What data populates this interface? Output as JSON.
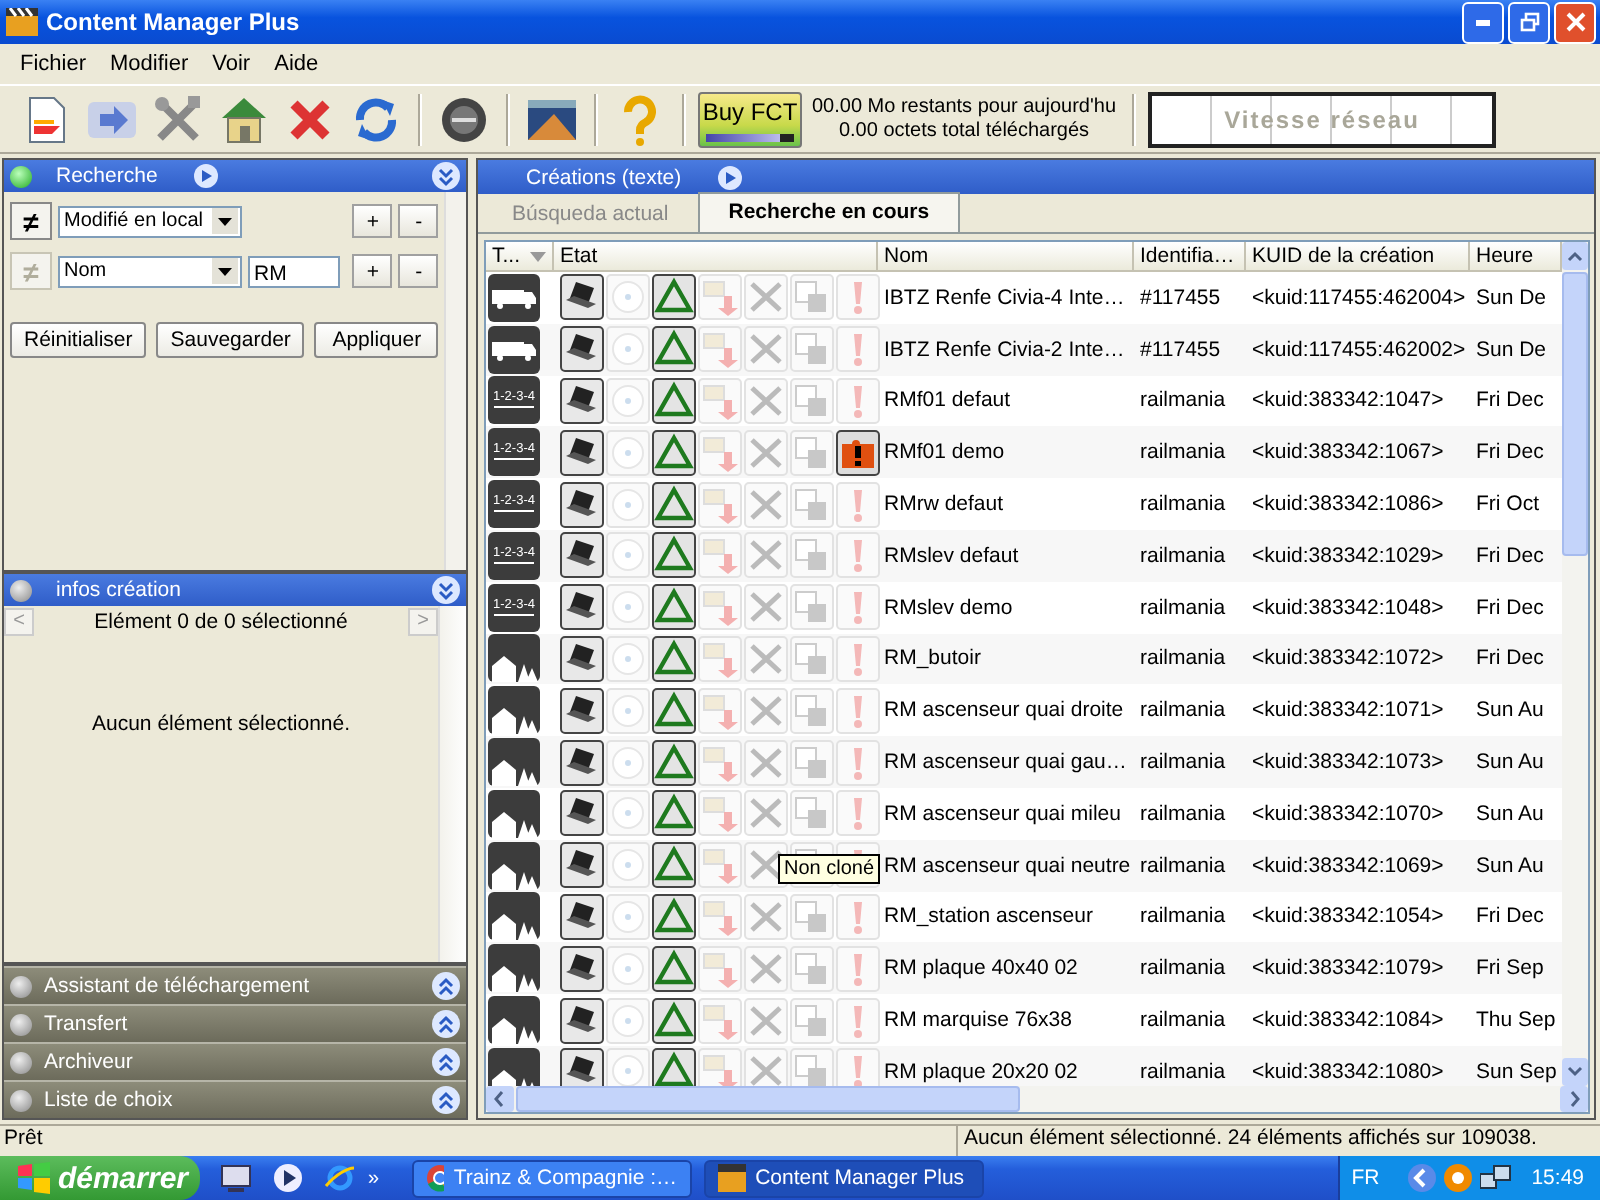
{
  "window": {
    "title": "Content Manager Plus"
  },
  "menu": [
    "Fichier",
    "Modifier",
    "Voir",
    "Aide"
  ],
  "toolbar": {
    "buy": {
      "label": "Buy FCT",
      "level": 0.85
    },
    "download_info": [
      "00.00 Mo restants pour aujourd'hu",
      "0.00 octets total téléchargés"
    ],
    "speed_label": "Vitesse réseau"
  },
  "search_panel": {
    "title": "Recherche",
    "active": true,
    "expanded": true,
    "filters": [
      {
        "kind": "select",
        "negate": "≠",
        "negate_enabled": true,
        "field": "Modifié en local",
        "plus": "+",
        "minus": "-"
      },
      {
        "kind": "text",
        "negate": "≠",
        "negate_enabled": false,
        "field": "Nom",
        "value": "RM",
        "plus": "+",
        "minus": "-"
      }
    ],
    "buttons": [
      "Réinitialiser",
      "Sauvegarder",
      "Appliquer"
    ]
  },
  "info_panel": {
    "title": "infos création",
    "active": false,
    "expanded": true,
    "prev": "<",
    "next": ">",
    "counter": "Elément 0 de 0 sélectionné",
    "message": "Aucun élément sélectionné."
  },
  "collapsed_panels": [
    {
      "title": "Assistant de téléchargement",
      "active": false,
      "expanded": false
    },
    {
      "title": "Transfert",
      "active": false,
      "expanded": false
    },
    {
      "title": "Archiveur",
      "active": false,
      "expanded": false
    },
    {
      "title": "Liste de choix",
      "active": false,
      "expanded": false
    }
  ],
  "main": {
    "title": "Créations (texte)",
    "tabs": [
      {
        "label": "Búsqueda actual",
        "selected": false
      },
      {
        "label": "Recherche en cours",
        "selected": true
      }
    ],
    "table": {
      "columns": [
        "T...",
        "Etat",
        "Nom",
        "Identifia…",
        "KUID de la création",
        "Heure"
      ],
      "rows": [
        {
          "kind": "truck",
          "error": false,
          "name": "IBTZ Renfe Civia-4 Inte…",
          "author": "#117455",
          "kuid": "<kuid:117455:462004>",
          "date": "Sun De"
        },
        {
          "kind": "truck",
          "error": false,
          "name": "IBTZ Renfe Civia-2 Inte…",
          "author": "#117455",
          "kuid": "<kuid:117455:462002>",
          "date": "Sun De"
        },
        {
          "kind": "rules",
          "type_label": "1-2-3-4",
          "error": false,
          "name": "RMf01 defaut",
          "author": "railmania",
          "kuid": "<kuid:383342:1047>",
          "date": "Fri Dec"
        },
        {
          "kind": "rules",
          "type_label": "1-2-3-4",
          "error": true,
          "name": "RMf01 demo",
          "author": "railmania",
          "kuid": "<kuid:383342:1067>",
          "date": "Fri Dec"
        },
        {
          "kind": "rules",
          "type_label": "1-2-3-4",
          "error": false,
          "name": "RMrw defaut",
          "author": "railmania",
          "kuid": "<kuid:383342:1086>",
          "date": "Fri Oct"
        },
        {
          "kind": "rules",
          "type_label": "1-2-3-4",
          "error": false,
          "name": "RMslev defaut",
          "author": "railmania",
          "kuid": "<kuid:383342:1029>",
          "date": "Fri Dec"
        },
        {
          "kind": "rules",
          "type_label": "1-2-3-4",
          "error": false,
          "name": "RMslev demo",
          "author": "railmania",
          "kuid": "<kuid:383342:1048>",
          "date": "Fri Dec"
        },
        {
          "kind": "scenery",
          "error": false,
          "name": "RM_butoir",
          "author": "railmania",
          "kuid": "<kuid:383342:1072>",
          "date": "Fri Dec"
        },
        {
          "kind": "scenery",
          "error": false,
          "name": "RM ascenseur quai droite",
          "author": "railmania",
          "kuid": "<kuid:383342:1071>",
          "date": "Sun Au"
        },
        {
          "kind": "scenery",
          "error": false,
          "name": "RM ascenseur quai gau…",
          "author": "railmania",
          "kuid": "<kuid:383342:1073>",
          "date": "Sun Au"
        },
        {
          "kind": "scenery",
          "error": false,
          "name": "RM ascenseur quai mileu",
          "author": "railmania",
          "kuid": "<kuid:383342:1070>",
          "date": "Sun Au"
        },
        {
          "kind": "scenery",
          "error": false,
          "name": "RM ascenseur quai neutre",
          "author": "railmania",
          "kuid": "<kuid:383342:1069>",
          "date": "Sun Au"
        },
        {
          "kind": "scenery",
          "error": false,
          "name": "RM_station ascenseur",
          "author": "railmania",
          "kuid": "<kuid:383342:1054>",
          "date": "Fri Dec"
        },
        {
          "kind": "scenery",
          "error": false,
          "name": "RM plaque 40x40 02",
          "author": "railmania",
          "kuid": "<kuid:383342:1079>",
          "date": "Fri Sep"
        },
        {
          "kind": "scenery",
          "error": false,
          "name": "RM marquise 76x38",
          "author": "railmania",
          "kuid": "<kuid:383342:1084>",
          "date": "Thu Sep"
        },
        {
          "kind": "scenery",
          "error": false,
          "name": "RM plaque 20x20 02",
          "author": "railmania",
          "kuid": "<kuid:383342:1080>",
          "date": "Sun Sep"
        }
      ]
    },
    "tooltip": "Non cloné"
  },
  "status_bar": {
    "left": "Prêt",
    "right": "Aucun élément sélectionné. 24 éléments affichés sur 109038."
  },
  "taskbar": {
    "start": "démarrer",
    "more": "»",
    "tasks": [
      {
        "kind": "browser",
        "label": "Trainz & Compagnie :…",
        "selected": false
      },
      {
        "kind": "app",
        "label": "Content Manager Plus",
        "selected": true
      }
    ],
    "language": "FR",
    "clock": "15:49"
  }
}
